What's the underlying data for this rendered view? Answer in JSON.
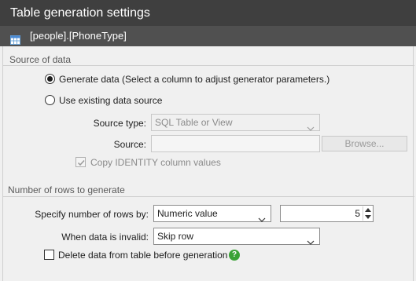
{
  "window": {
    "title": "Table generation settings"
  },
  "table": {
    "name": "[people].[PhoneType]",
    "icon": "table-icon"
  },
  "source_section": {
    "title": "Source of data",
    "generate_label": "Generate data (Select a column to adjust generator parameters.)",
    "generate_selected": true,
    "existing_label": "Use existing data source",
    "existing_selected": false,
    "source_type_label": "Source type:",
    "source_type_value": "SQL Table or View",
    "source_label": "Source:",
    "source_value": "",
    "browse_label": "Browse...",
    "copy_identity_label": "Copy IDENTITY column values",
    "copy_identity_checked": true
  },
  "rows_section": {
    "title": "Number of rows to generate",
    "specify_label": "Specify number of rows by:",
    "specify_value": "Numeric value",
    "row_count": "5",
    "invalid_label": "When data is invalid:",
    "invalid_value": "Skip row",
    "delete_label": "Delete data from table before generation",
    "delete_checked": false,
    "help_icon": "help-icon",
    "help_glyph": "?"
  },
  "colors": {
    "titlebar": "#3f3f3f",
    "tablebar": "#505050",
    "background": "#f0f0f0",
    "help_green": "#3aa235"
  }
}
